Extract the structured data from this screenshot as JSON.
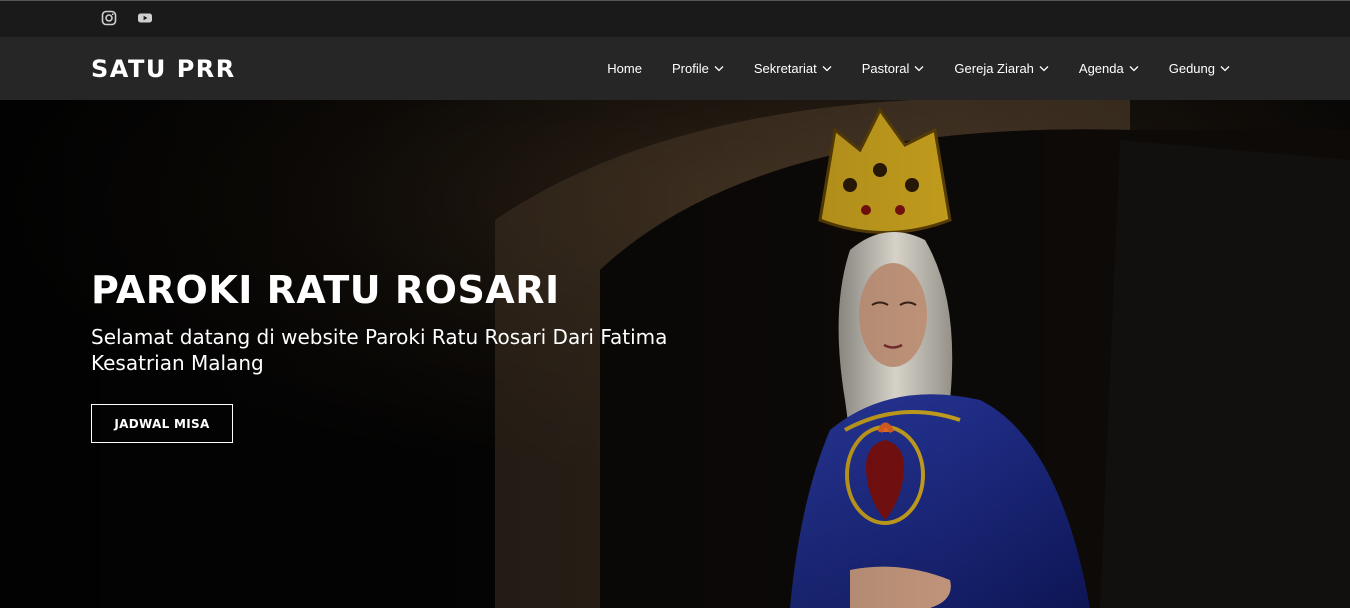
{
  "social": {
    "instagram_icon": "instagram-icon",
    "youtube_icon": "youtube-icon"
  },
  "brand": {
    "name": "SATU PRR"
  },
  "nav": {
    "items": [
      {
        "label": "Home",
        "has_dropdown": false
      },
      {
        "label": "Profile",
        "has_dropdown": true
      },
      {
        "label": "Sekretariat",
        "has_dropdown": true
      },
      {
        "label": "Pastoral",
        "has_dropdown": true
      },
      {
        "label": "Gereja Ziarah",
        "has_dropdown": true
      },
      {
        "label": "Agenda",
        "has_dropdown": true
      },
      {
        "label": "Gedung",
        "has_dropdown": true
      }
    ]
  },
  "hero": {
    "title": "PAROKI RATU ROSARI",
    "subtitle": "Selamat datang di website Paroki Ratu Rosari Dari Fatima Kesatrian Malang",
    "cta_label": "JADWAL MISA"
  },
  "colors": {
    "topbar_bg": "#1a1a1a",
    "navbar_bg": "#262626",
    "robe_blue": "#1c2c8c",
    "crown_gold": "#c9a21e"
  }
}
